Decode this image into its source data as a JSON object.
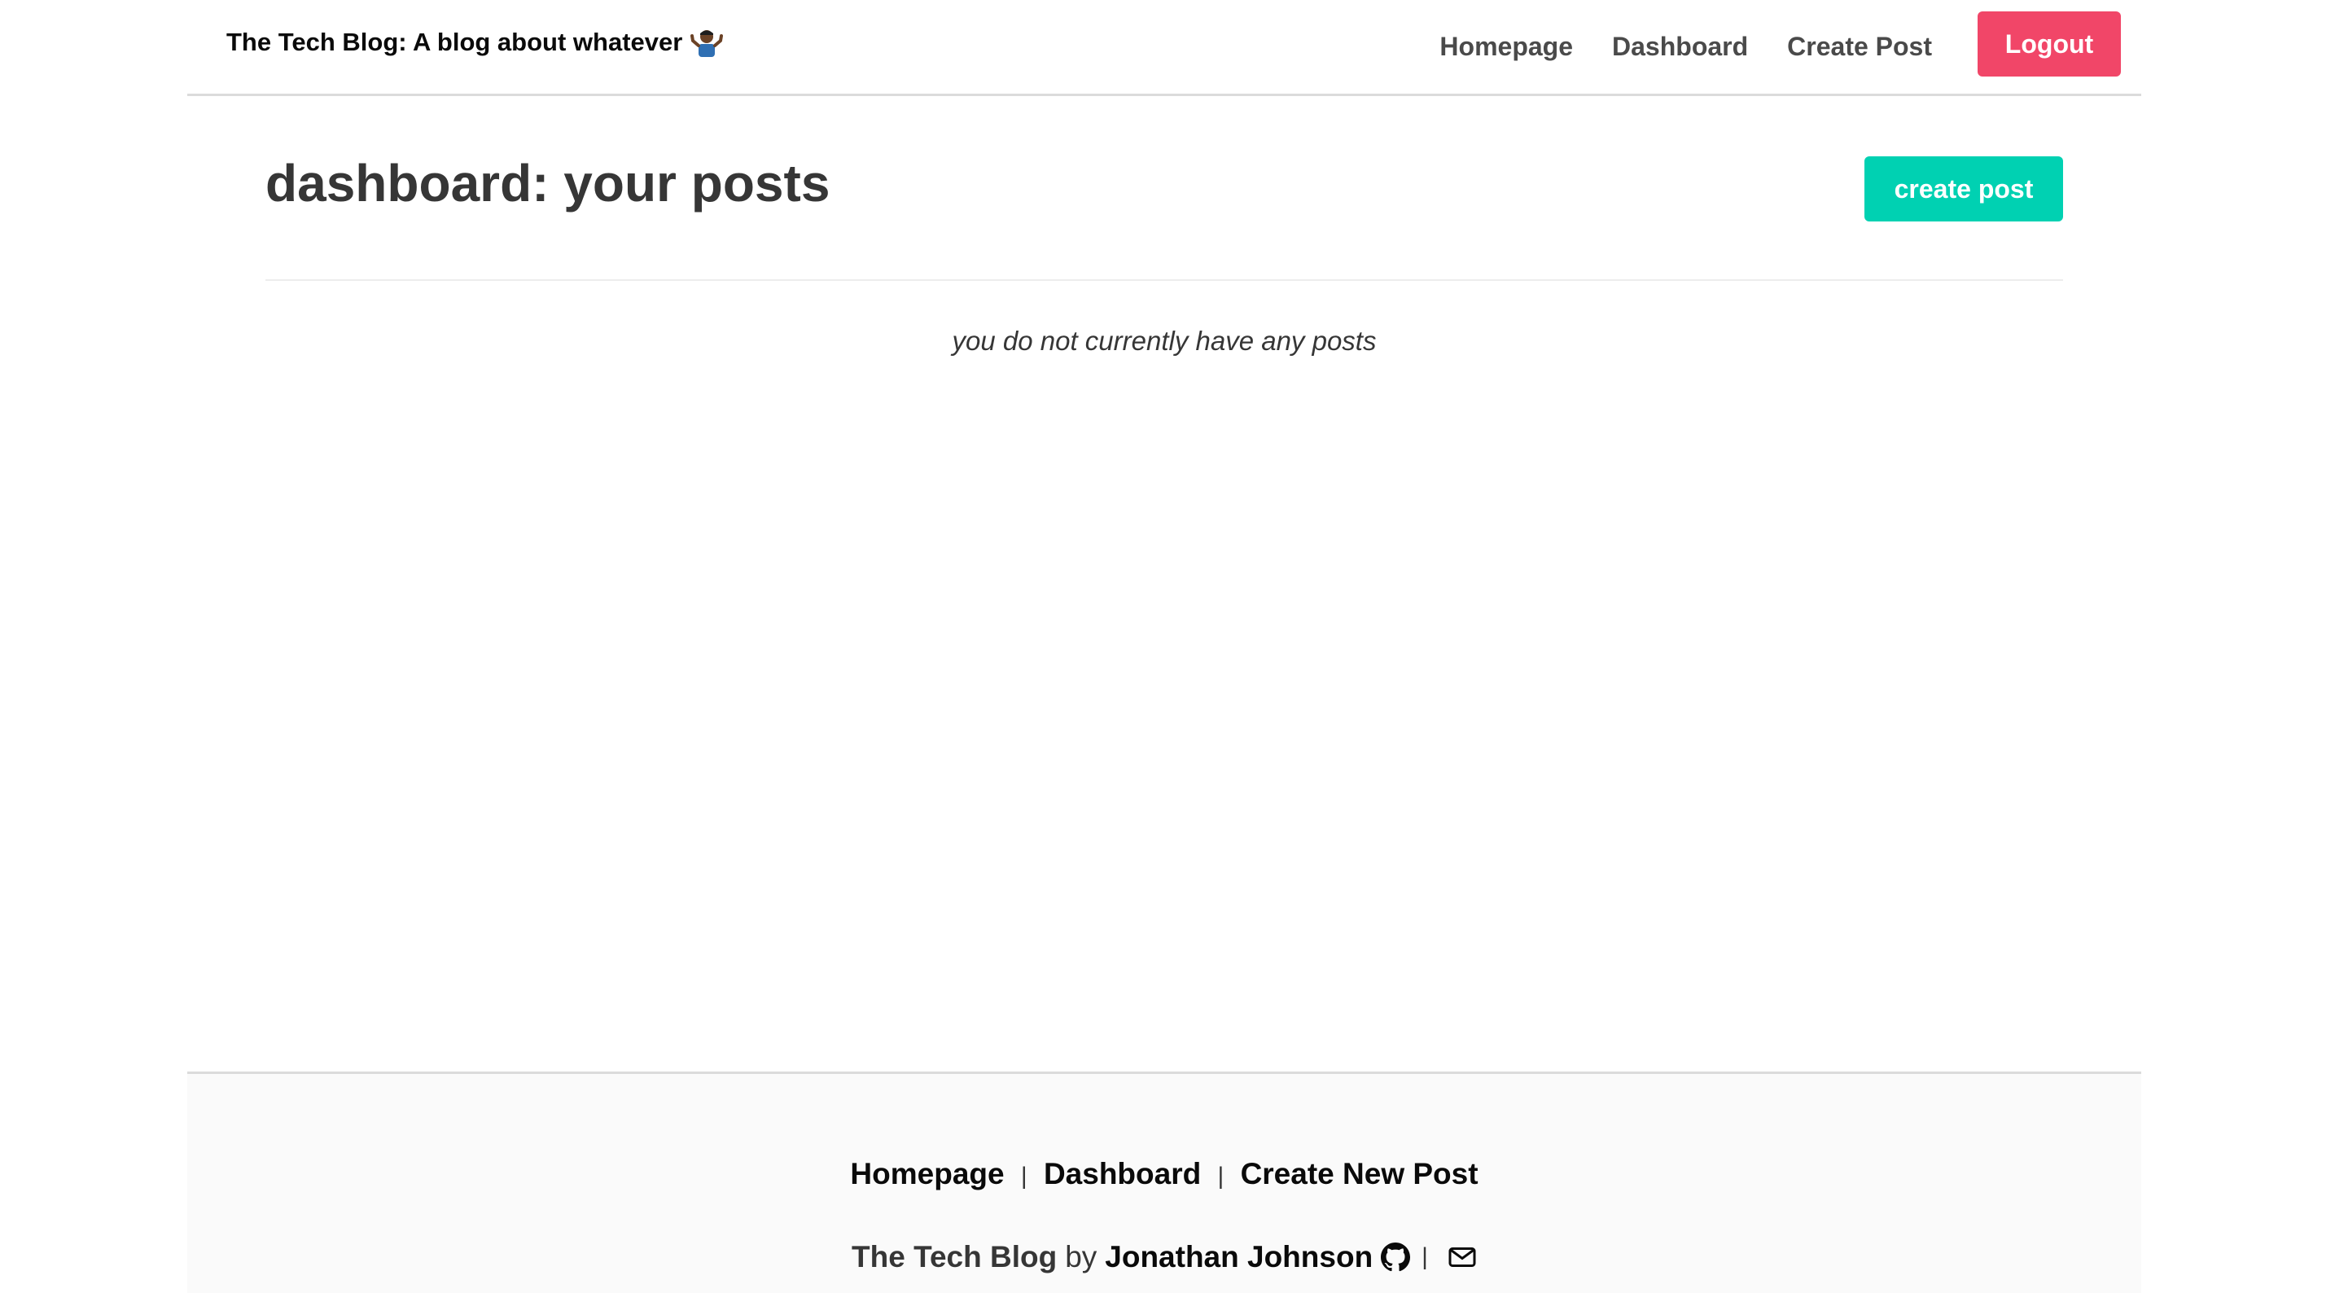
{
  "header": {
    "brand_text": "The Tech Blog: A blog about whatever",
    "brand_emoji_icon": "person-shrugging-icon",
    "nav": {
      "homepage": "Homepage",
      "dashboard": "Dashboard",
      "create_post": "Create Post",
      "logout": "Logout"
    }
  },
  "main": {
    "title": "dashboard: your posts",
    "create_button": "create post",
    "empty_message": "you do not currently have any posts"
  },
  "footer": {
    "links": {
      "homepage": "Homepage",
      "dashboard": "Dashboard",
      "create_new_post": "Create New Post"
    },
    "separator": "|",
    "blog_name": "The Tech Blog",
    "by": "by",
    "author": "Jonathan Johnson",
    "github_icon": "github-icon",
    "email_icon": "envelope-icon"
  },
  "colors": {
    "logout_button": "#f14668",
    "create_button": "#00d1b2",
    "footer_background": "#fafafa"
  }
}
